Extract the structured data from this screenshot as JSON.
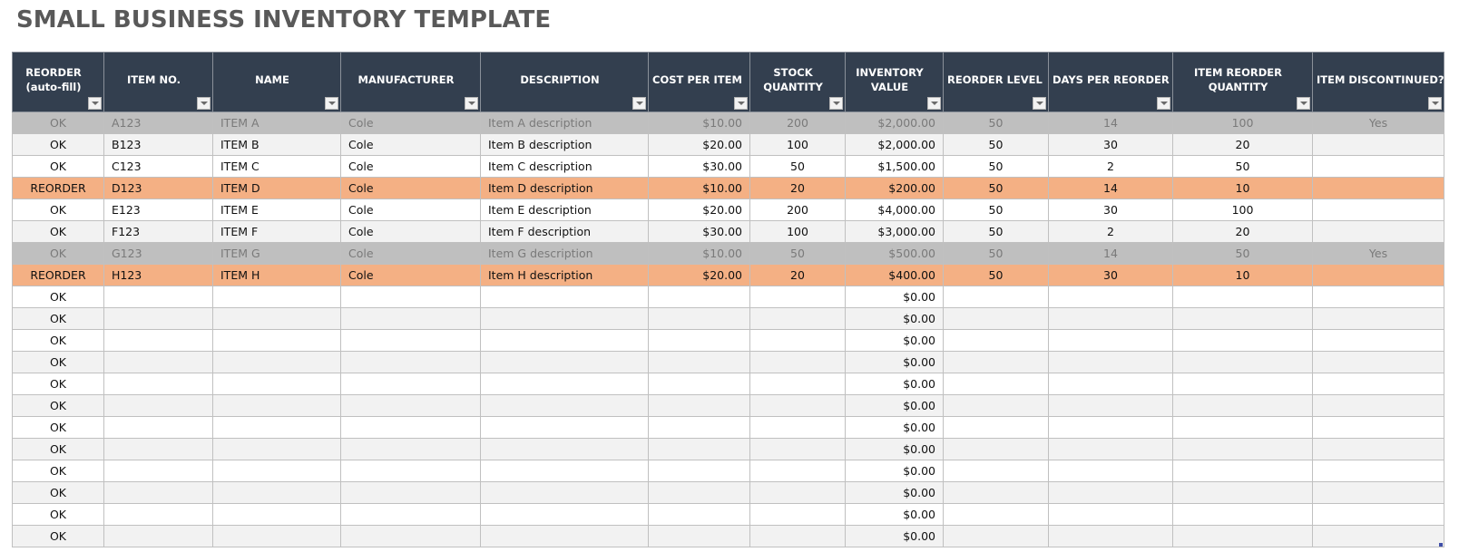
{
  "title": "SMALL BUSINESS INVENTORY TEMPLATE",
  "icons": {
    "filter": "dropdown-filter-icon"
  },
  "colors": {
    "header_bg": "#333f4f",
    "header_text": "#ffffff",
    "reorder_row": "#f4b084",
    "discontinued_row": "#bfbfbf",
    "alt_row": "#f2f2f2",
    "title_text": "#595959"
  },
  "columns": [
    {
      "key": "reorder",
      "label": "REORDER (auto-fill)"
    },
    {
      "key": "item_no",
      "label": "ITEM NO."
    },
    {
      "key": "name",
      "label": "NAME"
    },
    {
      "key": "manufacturer",
      "label": "MANUFACTURER"
    },
    {
      "key": "description",
      "label": "DESCRIPTION"
    },
    {
      "key": "cost",
      "label": "COST PER ITEM"
    },
    {
      "key": "stock",
      "label": "STOCK QUANTITY"
    },
    {
      "key": "value",
      "label": "INVENTORY VALUE"
    },
    {
      "key": "reorder_level",
      "label": "REORDER LEVEL"
    },
    {
      "key": "days",
      "label": "DAYS PER REORDER"
    },
    {
      "key": "reorder_qty",
      "label": "ITEM REORDER QUANTITY"
    },
    {
      "key": "discontinued",
      "label": "ITEM DISCONTINUED?"
    }
  ],
  "rows": [
    {
      "status": "disc",
      "cells": [
        "OK",
        "A123",
        "ITEM A",
        "Cole",
        "Item A description",
        "$10.00",
        "200",
        "$2,000.00",
        "50",
        "14",
        "100",
        "Yes"
      ]
    },
    {
      "status": "alt",
      "cells": [
        "OK",
        "B123",
        "ITEM B",
        "Cole",
        "Item B description",
        "$20.00",
        "100",
        "$2,000.00",
        "50",
        "30",
        "20",
        ""
      ]
    },
    {
      "status": "white",
      "cells": [
        "OK",
        "C123",
        "ITEM C",
        "Cole",
        "Item C description",
        "$30.00",
        "50",
        "$1,500.00",
        "50",
        "2",
        "50",
        ""
      ]
    },
    {
      "status": "reorder",
      "cells": [
        "REORDER",
        "D123",
        "ITEM D",
        "Cole",
        "Item D description",
        "$10.00",
        "20",
        "$200.00",
        "50",
        "14",
        "10",
        ""
      ]
    },
    {
      "status": "white",
      "cells": [
        "OK",
        "E123",
        "ITEM E",
        "Cole",
        "Item E description",
        "$20.00",
        "200",
        "$4,000.00",
        "50",
        "30",
        "100",
        ""
      ]
    },
    {
      "status": "alt",
      "cells": [
        "OK",
        "F123",
        "ITEM F",
        "Cole",
        "Item F description",
        "$30.00",
        "100",
        "$3,000.00",
        "50",
        "2",
        "20",
        ""
      ]
    },
    {
      "status": "disc",
      "cells": [
        "OK",
        "G123",
        "ITEM G",
        "Cole",
        "Item G description",
        "$10.00",
        "50",
        "$500.00",
        "50",
        "14",
        "50",
        "Yes"
      ]
    },
    {
      "status": "reorder",
      "cells": [
        "REORDER",
        "H123",
        "ITEM H",
        "Cole",
        "Item H description",
        "$20.00",
        "20",
        "$400.00",
        "50",
        "30",
        "10",
        ""
      ]
    },
    {
      "status": "white",
      "cells": [
        "OK",
        "",
        "",
        "",
        "",
        "",
        "",
        "$0.00",
        "",
        "",
        "",
        ""
      ]
    },
    {
      "status": "alt",
      "cells": [
        "OK",
        "",
        "",
        "",
        "",
        "",
        "",
        "$0.00",
        "",
        "",
        "",
        ""
      ]
    },
    {
      "status": "white",
      "cells": [
        "OK",
        "",
        "",
        "",
        "",
        "",
        "",
        "$0.00",
        "",
        "",
        "",
        ""
      ]
    },
    {
      "status": "alt",
      "cells": [
        "OK",
        "",
        "",
        "",
        "",
        "",
        "",
        "$0.00",
        "",
        "",
        "",
        ""
      ]
    },
    {
      "status": "white",
      "cells": [
        "OK",
        "",
        "",
        "",
        "",
        "",
        "",
        "$0.00",
        "",
        "",
        "",
        ""
      ]
    },
    {
      "status": "alt",
      "cells": [
        "OK",
        "",
        "",
        "",
        "",
        "",
        "",
        "$0.00",
        "",
        "",
        "",
        ""
      ]
    },
    {
      "status": "white",
      "cells": [
        "OK",
        "",
        "",
        "",
        "",
        "",
        "",
        "$0.00",
        "",
        "",
        "",
        ""
      ]
    },
    {
      "status": "alt",
      "cells": [
        "OK",
        "",
        "",
        "",
        "",
        "",
        "",
        "$0.00",
        "",
        "",
        "",
        ""
      ]
    },
    {
      "status": "white",
      "cells": [
        "OK",
        "",
        "",
        "",
        "",
        "",
        "",
        "$0.00",
        "",
        "",
        "",
        ""
      ]
    },
    {
      "status": "alt",
      "cells": [
        "OK",
        "",
        "",
        "",
        "",
        "",
        "",
        "$0.00",
        "",
        "",
        "",
        ""
      ]
    },
    {
      "status": "white",
      "cells": [
        "OK",
        "",
        "",
        "",
        "",
        "",
        "",
        "$0.00",
        "",
        "",
        "",
        ""
      ]
    },
    {
      "status": "alt",
      "cells": [
        "OK",
        "",
        "",
        "",
        "",
        "",
        "",
        "$0.00",
        "",
        "",
        "",
        ""
      ]
    }
  ]
}
